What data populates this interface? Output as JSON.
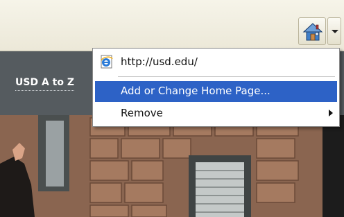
{
  "toolbar": {
    "home_icon": "house-icon",
    "dropdown_icon": "chevron-down-icon"
  },
  "site_nav": {
    "az_link": "USD A to Z"
  },
  "menu": {
    "items": [
      {
        "label": "http://usd.edu/",
        "icon": "ie-page-icon"
      },
      {
        "label": "Add or Change Home Page...",
        "selected": true
      },
      {
        "label": "Remove",
        "has_submenu": true
      }
    ]
  },
  "colors": {
    "highlight": "#2d62c6",
    "nav_background": "#555b5f",
    "toolbar_background": "#ece8d8"
  }
}
